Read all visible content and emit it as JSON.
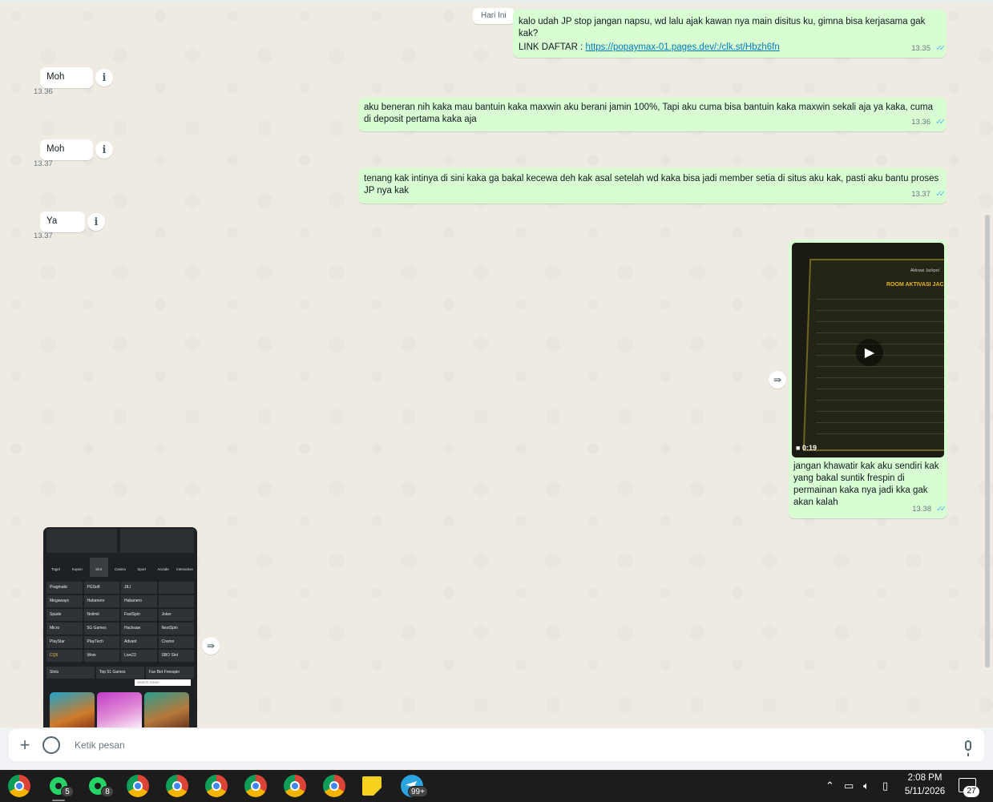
{
  "chat": {
    "date_label": "Hari Ini",
    "messages": [
      {
        "text": "kalo udah JP stop jangan napsu, wd lalu ajak kawan nya main disitus ku, gimna bisa kerjasama gak kak?",
        "link_prefix": "LINK DAFTAR : ",
        "link": "https://popaymax-01.pages.dev/:/clk.st/Hbzh6fn",
        "time": "13.35"
      },
      {
        "text": "Moh",
        "time": "13.36"
      },
      {
        "text": "aku beneran nih kaka mau bantuin kaka maxwin aku berani jamin 100%, Tapi aku cuma bisa bantuin kaka maxwin sekali aja ya kaka, cuma di deposit pertama kaka aja",
        "time": "13.36"
      },
      {
        "text": "Moh",
        "time": "13.37"
      },
      {
        "text": "tenang kak intinya di sini kaka ga bakal kecewa deh kak asal setelah wd kaka bisa jadi member setia di situs aku kak, pasti aku bantu proses JP nya kak",
        "time": "13.37"
      },
      {
        "text": "Ya",
        "time": "13.37"
      },
      {
        "video_title": "ROOM AKTIVASI JAC",
        "video_subtitle": "Aktivasi Jackpot",
        "duration": "0:19",
        "text": "jangan khawatir kak aku sendiri kak yang bakal suntik frespin di permainan kaka nya jadi kka gak akan kalah",
        "time": "13.38"
      }
    ],
    "image_msg": {
      "tabs": [
        "Togel",
        "Kupon",
        "Slot",
        "Casino",
        "Sport",
        "Arcade",
        "Interactive"
      ],
      "providers": [
        "Pragmatic",
        "PGSoft",
        "JILI",
        "",
        "Megaways",
        "Habanero",
        "Habanero",
        "",
        "Spade",
        "Nolimit",
        "FastSpin",
        "Joker",
        "Micro",
        "5G Games",
        "Hacksaw",
        "NextSpin",
        "PlayStar",
        "PlayTech",
        "Advant",
        "Cosmo",
        "CQ9",
        "Wow",
        "Live22",
        "SBO Slot"
      ],
      "filters": [
        "Slots",
        "Top 51 Games",
        "Fav Bet Freespin"
      ],
      "search_placeholder": "Search Game"
    }
  },
  "composer": {
    "placeholder": "Ketik pesan"
  },
  "taskbar": {
    "badges": [
      "5",
      "8",
      "99+"
    ],
    "clock_time": "2:08 PM",
    "clock_date": "5/11/2026",
    "notifications": "27"
  },
  "colors": {
    "bubble_out": "#d9fdd3",
    "bubble_in": "#ffffff",
    "tick_read": "#53bdeb"
  }
}
